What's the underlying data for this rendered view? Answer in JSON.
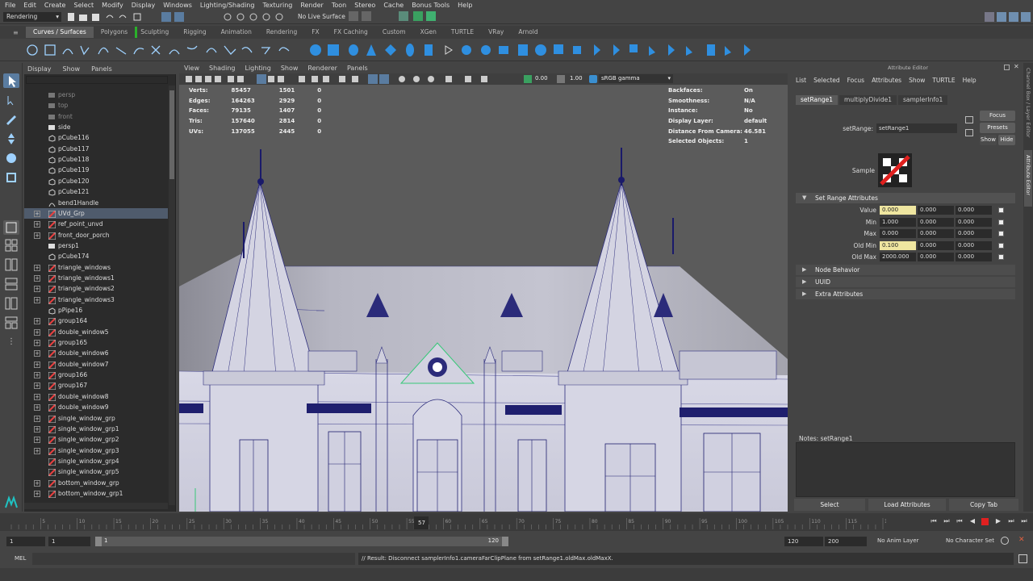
{
  "menubar": [
    "File",
    "Edit",
    "Create",
    "Select",
    "Modify",
    "Display",
    "Windows",
    "Lighting/Shading",
    "Texturing",
    "Render",
    "Toon",
    "Stereo",
    "Cache",
    "Bonus Tools",
    "Help"
  ],
  "status": {
    "mode": "Rendering",
    "live": "No Live Surface"
  },
  "shelf_tabs": [
    "Curves / Surfaces",
    "Polygons",
    "Sculpting",
    "Rigging",
    "Animation",
    "Rendering",
    "FX",
    "FX Caching",
    "Custom",
    "XGen",
    "TURTLE",
    "VRay",
    "Arnold"
  ],
  "outliner": {
    "menu": [
      "Display",
      "Show",
      "Panels"
    ],
    "rows": [
      {
        "label": "persp",
        "dim": true,
        "kind": "cam"
      },
      {
        "label": "top",
        "dim": true,
        "kind": "cam"
      },
      {
        "label": "front",
        "dim": true,
        "kind": "cam"
      },
      {
        "label": "side",
        "dim": false,
        "kind": "cam"
      },
      {
        "label": "pCube116",
        "kind": "mesh"
      },
      {
        "label": "pCube117",
        "kind": "mesh"
      },
      {
        "label": "pCube118",
        "kind": "mesh"
      },
      {
        "label": "pCube119",
        "kind": "mesh"
      },
      {
        "label": "pCube120",
        "kind": "mesh"
      },
      {
        "label": "pCube121",
        "kind": "mesh"
      },
      {
        "label": "bend1Handle",
        "kind": "deform"
      },
      {
        "label": "UVd_Grp",
        "kind": "group",
        "expand": true,
        "selected": true
      },
      {
        "label": "ref_point_unvd",
        "kind": "group",
        "expand": true
      },
      {
        "label": "front_door_porch",
        "kind": "group",
        "expand": true
      },
      {
        "label": "persp1",
        "kind": "cam"
      },
      {
        "label": "pCube174",
        "kind": "mesh"
      },
      {
        "label": "triangle_windows",
        "kind": "group",
        "expand": true
      },
      {
        "label": "triangle_windows1",
        "kind": "group",
        "expand": true
      },
      {
        "label": "triangle_windows2",
        "kind": "group",
        "expand": true
      },
      {
        "label": "triangle_windows3",
        "kind": "group",
        "expand": true
      },
      {
        "label": "pPipe16",
        "kind": "mesh"
      },
      {
        "label": "group164",
        "kind": "group",
        "expand": true
      },
      {
        "label": "double_window5",
        "kind": "group",
        "expand": true
      },
      {
        "label": "group165",
        "kind": "group",
        "expand": true
      },
      {
        "label": "double_window6",
        "kind": "group",
        "expand": true
      },
      {
        "label": "double_window7",
        "kind": "group",
        "expand": true
      },
      {
        "label": "group166",
        "kind": "group",
        "expand": true
      },
      {
        "label": "group167",
        "kind": "group",
        "expand": true
      },
      {
        "label": "double_window8",
        "kind": "group",
        "expand": true
      },
      {
        "label": "double_window9",
        "kind": "group",
        "expand": true
      },
      {
        "label": "single_window_grp",
        "kind": "group",
        "expand": true
      },
      {
        "label": "single_window_grp1",
        "kind": "group",
        "expand": true
      },
      {
        "label": "single_window_grp2",
        "kind": "group",
        "expand": true
      },
      {
        "label": "single_window_grp3",
        "kind": "group",
        "expand": true
      },
      {
        "label": "single_window_grp4",
        "kind": "group",
        "expand": false
      },
      {
        "label": "single_window_grp5",
        "kind": "group",
        "expand": false
      },
      {
        "label": "bottom_window_grp",
        "kind": "group",
        "expand": true
      },
      {
        "label": "bottom_window_grp1",
        "kind": "group",
        "expand": true
      }
    ]
  },
  "viewport": {
    "menu": [
      "View",
      "Shading",
      "Lighting",
      "Show",
      "Renderer",
      "Panels"
    ],
    "exposure": "0.00",
    "gamma": "1.00",
    "colorspace": "sRGB gamma",
    "stats": [
      {
        "k": "Verts:",
        "a": "85457",
        "b": "1501",
        "c": "0"
      },
      {
        "k": "Edges:",
        "a": "164263",
        "b": "2929",
        "c": "0"
      },
      {
        "k": "Faces:",
        "a": "79135",
        "b": "1407",
        "c": "0"
      },
      {
        "k": "Tris:",
        "a": "157640",
        "b": "2814",
        "c": "0"
      },
      {
        "k": "UVs:",
        "a": "137055",
        "b": "2445",
        "c": "0"
      }
    ],
    "info": [
      {
        "k": "Backfaces:",
        "v": "On"
      },
      {
        "k": "Smoothness:",
        "v": "N/A"
      },
      {
        "k": "Instance:",
        "v": "No"
      },
      {
        "k": "Display Layer:",
        "v": "default"
      },
      {
        "k": "Distance From Camera:",
        "v": "46.581"
      },
      {
        "k": "Selected Objects:",
        "v": "1"
      }
    ]
  },
  "attribute_editor": {
    "title": "Attribute Editor",
    "menu": [
      "List",
      "Selected",
      "Focus",
      "Attributes",
      "Show",
      "TURTLE",
      "Help"
    ],
    "tabs": [
      "setRange1",
      "multiplyDivide1",
      "samplerInfo1"
    ],
    "node_label": "setRange:",
    "node_name": "setRange1",
    "focus": "Focus",
    "presets": "Presets",
    "show": "Show",
    "hide": "Hide",
    "sample": "Sample",
    "section": "Set Range Attributes",
    "attrs": [
      {
        "name": "Value",
        "v": [
          "0.000",
          "0.000",
          "0.000"
        ],
        "hl": true
      },
      {
        "name": "Min",
        "v": [
          "1.000",
          "0.000",
          "0.000"
        ],
        "hl": false
      },
      {
        "name": "Max",
        "v": [
          "0.000",
          "0.000",
          "0.000"
        ],
        "hl": false
      },
      {
        "name": "Old Min",
        "v": [
          "0.100",
          "0.000",
          "0.000"
        ],
        "hl": true
      },
      {
        "name": "Old Max",
        "v": [
          "2000.000",
          "0.000",
          "0.000"
        ],
        "hl": false
      }
    ],
    "collapsed": [
      "Node Behavior",
      "UUID",
      "Extra Attributes"
    ],
    "notes": "Notes:  setRange1",
    "buttons": [
      "Select",
      "Load Attributes",
      "Copy Tab"
    ]
  },
  "side_tabs": [
    "Channel Box / Layer Editor",
    "Attribute Editor"
  ],
  "timeline": {
    "labels": [
      "5",
      "10",
      "15",
      "20",
      "25",
      "30",
      "35",
      "40",
      "45",
      "50",
      "55",
      "60",
      "65",
      "70",
      "75",
      "80",
      "85",
      "90",
      "95",
      "100",
      "105",
      "110",
      "115",
      "120"
    ],
    "current": "57"
  },
  "range": {
    "start": "1",
    "inner_start": "1",
    "slider_start": "1",
    "slider_end": "120",
    "end": "120",
    "max": "200",
    "anim_layer": "No Anim Layer",
    "char_set": "No Character Set"
  },
  "command": {
    "lang": "MEL",
    "result": "// Result: Disconnect samplerInfo1.cameraFarClipPlane from setRange1.oldMax.oldMaxX."
  }
}
